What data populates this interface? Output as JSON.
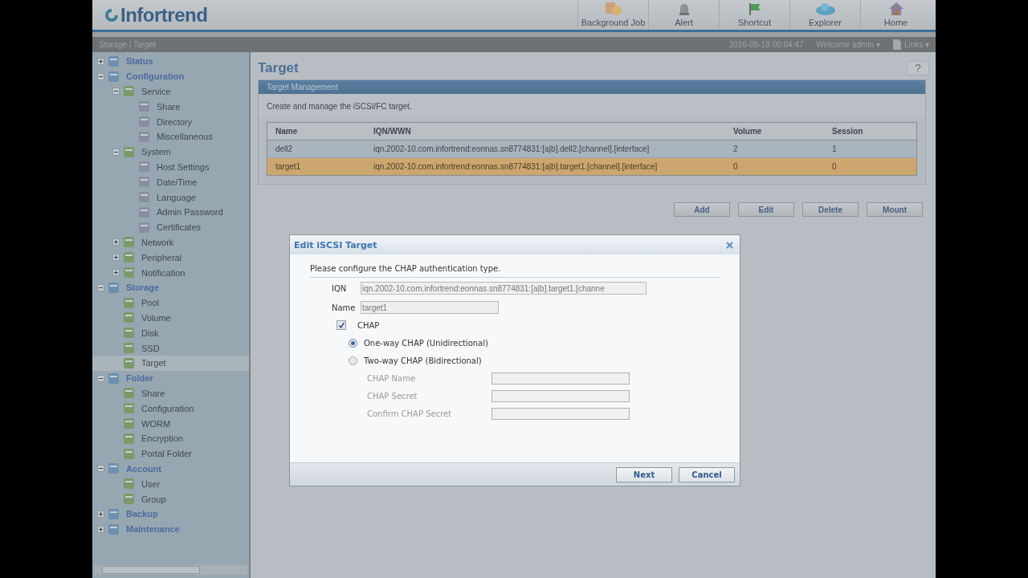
{
  "header": {
    "logo": "Infortrend",
    "buttons": [
      {
        "label": "Background Job",
        "kind": "job"
      },
      {
        "label": "Alert",
        "kind": "alert"
      },
      {
        "label": "Shortcut",
        "kind": "shortcut"
      },
      {
        "label": "Explorer",
        "kind": "explorer"
      },
      {
        "label": "Home",
        "kind": "home"
      }
    ]
  },
  "breadcrumb": "Storage | Target",
  "status": {
    "datetime": "2016-05-18 00:04:47",
    "user_menu": "Welcome admin ▾",
    "links_menu": "Links ▾"
  },
  "sidebar": {
    "tree": [
      {
        "label": "Status",
        "expanded": false,
        "selected": false
      },
      {
        "label": "Configuration",
        "expanded": true,
        "selected": false,
        "children": [
          {
            "label": "Service",
            "expanded": true,
            "selected": false,
            "children": [
              {
                "label": "Share",
                "selected": false
              },
              {
                "label": "Directory",
                "selected": false
              },
              {
                "label": "Miscellaneous",
                "selected": false
              }
            ]
          },
          {
            "label": "System",
            "expanded": true,
            "selected": false,
            "children": [
              {
                "label": "Host Settings",
                "selected": false
              },
              {
                "label": "Date/Time",
                "selected": false
              },
              {
                "label": "Language",
                "selected": false
              },
              {
                "label": "Admin Password",
                "selected": false
              },
              {
                "label": "Certificates",
                "selected": false
              }
            ]
          },
          {
            "label": "Network",
            "expanded": false,
            "selected": false
          },
          {
            "label": "Peripheral",
            "expanded": false,
            "selected": false
          },
          {
            "label": "Notification",
            "expanded": false,
            "selected": false
          }
        ]
      },
      {
        "label": "Storage",
        "expanded": true,
        "selected": false,
        "children": [
          {
            "label": "Pool",
            "selected": false
          },
          {
            "label": "Volume",
            "selected": false
          },
          {
            "label": "Disk",
            "selected": false
          },
          {
            "label": "SSD",
            "selected": false
          },
          {
            "label": "Target",
            "selected": true
          }
        ]
      },
      {
        "label": "Folder",
        "expanded": true,
        "selected": false,
        "children": [
          {
            "label": "Share",
            "selected": false
          },
          {
            "label": "Configuration",
            "selected": false
          },
          {
            "label": "WORM",
            "selected": false
          },
          {
            "label": "Encryption",
            "selected": false
          },
          {
            "label": "Portal Folder",
            "selected": false
          }
        ]
      },
      {
        "label": "Account",
        "expanded": true,
        "selected": false,
        "children": [
          {
            "label": "User",
            "selected": false
          },
          {
            "label": "Group",
            "selected": false
          }
        ]
      },
      {
        "label": "Backup",
        "expanded": false,
        "selected": false
      },
      {
        "label": "Maintenance",
        "expanded": false,
        "selected": false
      }
    ]
  },
  "page": {
    "title": "Target",
    "help": "?",
    "panel": {
      "title": "Target Management",
      "description": "Create and manage the iSCSI/FC target.",
      "table": {
        "columns": [
          "Name",
          "IQN/WWN",
          "Volume",
          "Session"
        ],
        "rows": [
          {
            "cells": [
              "dell2",
              "iqn.2002-10.com.infortrend:eonnas.sn8774831:[a|b].dell2.[channel].[interface]",
              "2",
              "1"
            ],
            "selected": false
          },
          {
            "cells": [
              "target1",
              "iqn.2002-10.com.infortrend:eonnas.sn8774831:[a|b].target1.[channel].[interface]",
              "0",
              "0"
            ],
            "selected": true
          }
        ]
      }
    },
    "buttons": [
      "Add",
      "Edit",
      "Delete",
      "Mount"
    ]
  },
  "dialog": {
    "title": "Edit iSCSI Target",
    "instruction": "Please configure the CHAP authentication type.",
    "fields": [
      {
        "label": "IQN",
        "value": "iqn.2002-10.com.infortrend:eonnas.sn8774831:[a|b].target1.[channe"
      },
      {
        "label": "Name",
        "value": "target1"
      }
    ],
    "chap": {
      "label": "CHAP",
      "checked": true
    },
    "options": [
      {
        "label": "One-way CHAP (Unidirectional)",
        "selected": true
      },
      {
        "label": "Two-way CHAP (Bidirectional)",
        "selected": false
      }
    ],
    "secret_fields": [
      {
        "label": "CHAP Name",
        "disabled": true
      },
      {
        "label": "CHAP Secret",
        "disabled": true
      },
      {
        "label": "Confirm CHAP Secret",
        "disabled": true
      }
    ],
    "buttons": [
      "Next",
      "Cancel"
    ]
  }
}
